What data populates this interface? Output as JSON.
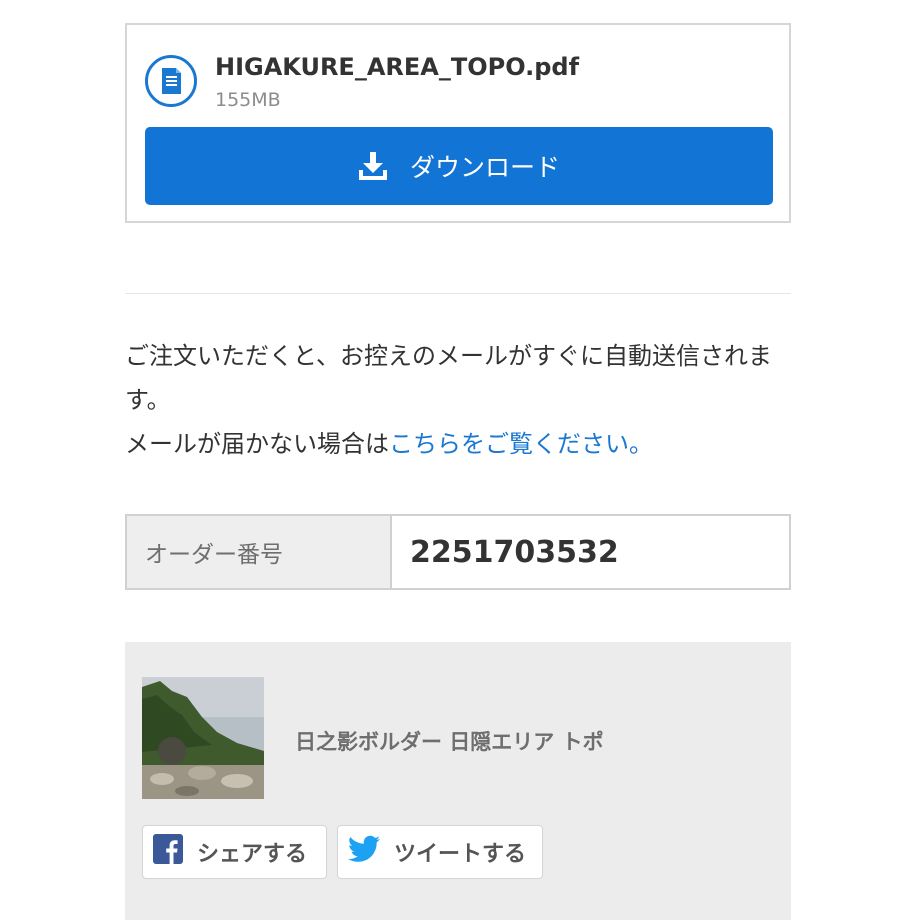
{
  "file": {
    "name": "HIGAKURE_AREA_TOPO.pdf",
    "size": "155MB",
    "download_label": "ダウンロード"
  },
  "notice": {
    "line1": "ご注文いただくと、お控えのメールがすぐに自動送信されます。",
    "line2_prefix": "メールが届かない場合は",
    "line2_link": "こちらをご覧ください。"
  },
  "order": {
    "label": "オーダー番号",
    "number": "2251703532"
  },
  "product": {
    "title": "日之影ボルダー 日隠エリア トポ"
  },
  "share": {
    "facebook_label": "シェアする",
    "twitter_label": "ツイートする"
  },
  "colors": {
    "accent": "#1275d6",
    "link": "#1b78d0",
    "panel_bg": "#ececec",
    "facebook": "#3b5998",
    "twitter": "#1da1f2"
  }
}
